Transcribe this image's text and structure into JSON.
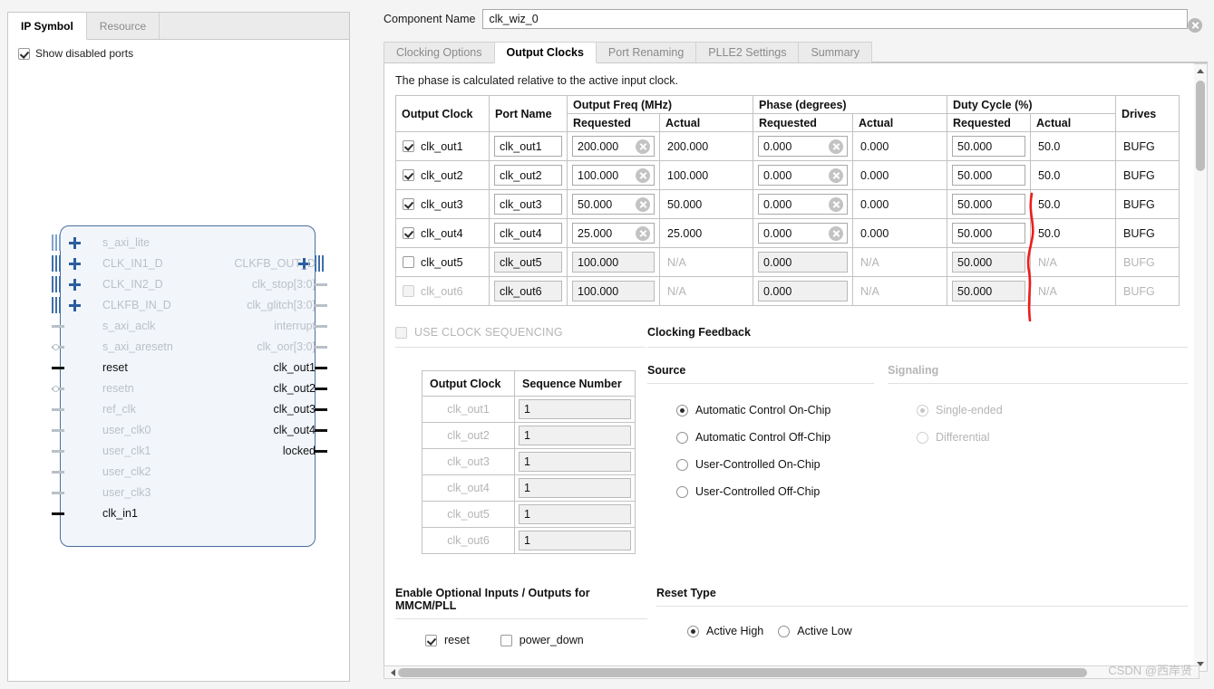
{
  "left_panel": {
    "tabs": [
      {
        "label": "IP Symbol",
        "active": true
      },
      {
        "label": "Resource",
        "active": false
      }
    ],
    "show_disabled_ports_label": "Show disabled ports",
    "show_disabled_ports_checked": true,
    "symbol": {
      "left_ports": [
        {
          "name": "s_axi_lite",
          "enabled": false,
          "kind": "bus-dotted"
        },
        {
          "name": "CLK_IN1_D",
          "enabled": false,
          "kind": "bus"
        },
        {
          "name": "CLK_IN2_D",
          "enabled": false,
          "kind": "bus"
        },
        {
          "name": "CLKFB_IN_D",
          "enabled": false,
          "kind": "bus"
        },
        {
          "name": "s_axi_aclk",
          "enabled": false,
          "kind": "wire"
        },
        {
          "name": "s_axi_aresetn",
          "enabled": false,
          "kind": "wire-inv"
        },
        {
          "name": "reset",
          "enabled": true,
          "kind": "wire"
        },
        {
          "name": "resetn",
          "enabled": false,
          "kind": "wire-inv"
        },
        {
          "name": "ref_clk",
          "enabled": false,
          "kind": "wire"
        },
        {
          "name": "user_clk0",
          "enabled": false,
          "kind": "wire"
        },
        {
          "name": "user_clk1",
          "enabled": false,
          "kind": "wire"
        },
        {
          "name": "user_clk2",
          "enabled": false,
          "kind": "wire"
        },
        {
          "name": "user_clk3",
          "enabled": false,
          "kind": "wire"
        },
        {
          "name": "clk_in1",
          "enabled": true,
          "kind": "wire"
        }
      ],
      "right_ports": [
        {
          "name": "CLKFB_OUT_D",
          "enabled": false,
          "kind": "bus",
          "row": 2
        },
        {
          "name": "clk_stop[3:0]",
          "enabled": false,
          "kind": "wire",
          "row": 3
        },
        {
          "name": "clk_glitch[3:0]",
          "enabled": false,
          "kind": "wire",
          "row": 4
        },
        {
          "name": "interrupt",
          "enabled": false,
          "kind": "wire",
          "row": 5
        },
        {
          "name": "clk_oor[3:0]",
          "enabled": false,
          "kind": "wire",
          "row": 6
        },
        {
          "name": "clk_out1",
          "enabled": true,
          "kind": "wire",
          "row": 7
        },
        {
          "name": "clk_out2",
          "enabled": true,
          "kind": "wire",
          "row": 8
        },
        {
          "name": "clk_out3",
          "enabled": true,
          "kind": "wire",
          "row": 9
        },
        {
          "name": "clk_out4",
          "enabled": true,
          "kind": "wire",
          "row": 10
        },
        {
          "name": "locked",
          "enabled": true,
          "kind": "wire",
          "row": 11
        }
      ]
    }
  },
  "header": {
    "component_name_label": "Component Name",
    "component_name_value": "clk_wiz_0",
    "clear_icon": "clear-circle-icon"
  },
  "main_tabs": [
    {
      "label": "Clocking Options",
      "active": false
    },
    {
      "label": "Output Clocks",
      "active": true
    },
    {
      "label": "Port Renaming",
      "active": false
    },
    {
      "label": "PLLE2 Settings",
      "active": false
    },
    {
      "label": "Summary",
      "active": false
    }
  ],
  "content": {
    "hint": "The phase is calculated relative to the active input clock.",
    "table": {
      "group_headers": [
        {
          "label": "Output Clock",
          "rowspan": 2
        },
        {
          "label": "Port Name",
          "rowspan": 2
        },
        {
          "label": "Output Freq (MHz)",
          "colspan": 2
        },
        {
          "label": "Phase (degrees)",
          "colspan": 2
        },
        {
          "label": "Duty Cycle (%)",
          "colspan": 2
        },
        {
          "label": "Drives",
          "rowspan": 2
        }
      ],
      "sub_headers": [
        "Requested",
        "Actual",
        "Requested",
        "Actual",
        "Requested",
        "Actual"
      ],
      "rows": [
        {
          "clock": "clk_out1",
          "enabled": true,
          "locked": false,
          "port": "clk_out1",
          "freq_req": "200.000",
          "freq_act": "200.000",
          "phase_req": "0.000",
          "phase_act": "0.000",
          "duty_req": "50.000",
          "duty_act": "50.0",
          "drives": "BUFG"
        },
        {
          "clock": "clk_out2",
          "enabled": true,
          "locked": false,
          "port": "clk_out2",
          "freq_req": "100.000",
          "freq_act": "100.000",
          "phase_req": "0.000",
          "phase_act": "0.000",
          "duty_req": "50.000",
          "duty_act": "50.0",
          "drives": "BUFG"
        },
        {
          "clock": "clk_out3",
          "enabled": true,
          "locked": false,
          "port": "clk_out3",
          "freq_req": "50.000",
          "freq_act": "50.000",
          "phase_req": "0.000",
          "phase_act": "0.000",
          "duty_req": "50.000",
          "duty_act": "50.0",
          "drives": "BUFG"
        },
        {
          "clock": "clk_out4",
          "enabled": true,
          "locked": false,
          "port": "clk_out4",
          "freq_req": "25.000",
          "freq_act": "25.000",
          "phase_req": "0.000",
          "phase_act": "0.000",
          "duty_req": "50.000",
          "duty_act": "50.0",
          "drives": "BUFG"
        },
        {
          "clock": "clk_out5",
          "enabled": false,
          "locked": false,
          "port": "clk_out5",
          "freq_req": "100.000",
          "freq_act": "N/A",
          "phase_req": "0.000",
          "phase_act": "N/A",
          "duty_req": "50.000",
          "duty_act": "N/A",
          "drives": "BUFG"
        },
        {
          "clock": "clk_out6",
          "enabled": false,
          "locked": true,
          "port": "clk_out6",
          "freq_req": "100.000",
          "freq_act": "N/A",
          "phase_req": "0.000",
          "phase_act": "N/A",
          "duty_req": "50.000",
          "duty_act": "N/A",
          "drives": "BUFG"
        }
      ]
    },
    "sequencing": {
      "checkbox_label": "USE CLOCK SEQUENCING",
      "checked": false,
      "headers": [
        "Output Clock",
        "Sequence Number"
      ],
      "rows": [
        {
          "clock": "clk_out1",
          "seq": "1"
        },
        {
          "clock": "clk_out2",
          "seq": "1"
        },
        {
          "clock": "clk_out3",
          "seq": "1"
        },
        {
          "clock": "clk_out4",
          "seq": "1"
        },
        {
          "clock": "clk_out5",
          "seq": "1"
        },
        {
          "clock": "clk_out6",
          "seq": "1"
        }
      ]
    },
    "feedback": {
      "title": "Clocking Feedback",
      "source_title": "Source",
      "signaling_title": "Signaling",
      "source_options": [
        {
          "label": "Automatic Control On-Chip",
          "selected": true,
          "disabled": false
        },
        {
          "label": "Automatic Control Off-Chip",
          "selected": false,
          "disabled": false
        },
        {
          "label": "User-Controlled On-Chip",
          "selected": false,
          "disabled": false
        },
        {
          "label": "User-Controlled Off-Chip",
          "selected": false,
          "disabled": false
        }
      ],
      "signaling_options": [
        {
          "label": "Single-ended",
          "selected": true,
          "disabled": true
        },
        {
          "label": "Differential",
          "selected": false,
          "disabled": true
        }
      ]
    },
    "optional_io": {
      "title": "Enable Optional Inputs / Outputs for MMCM/PLL",
      "checkboxes": [
        {
          "label": "reset",
          "checked": true
        },
        {
          "label": "power_down",
          "checked": false
        }
      ]
    },
    "reset_type": {
      "title": "Reset Type",
      "options": [
        {
          "label": "Active High",
          "selected": true
        },
        {
          "label": "Active Low",
          "selected": false
        }
      ]
    }
  },
  "watermark": "CSDN @西岸贤",
  "colors": {
    "accent_blue": "#2b5e9e",
    "symbol_fill": "#f2f6fb",
    "symbol_border": "#4a6f9c",
    "annotation_red": "#ee1c1c",
    "disabled_text": "#b5b5b5"
  }
}
